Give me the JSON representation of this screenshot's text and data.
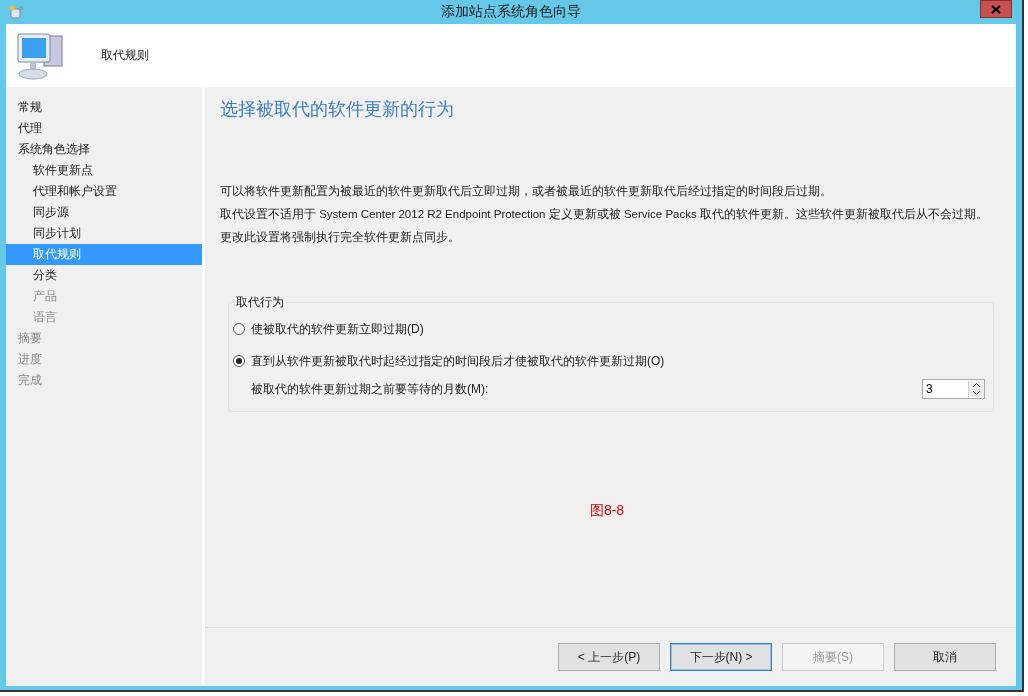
{
  "window": {
    "title": "添加站点系统角色向导"
  },
  "header": {
    "title": "取代规则"
  },
  "nav": [
    {
      "label": "常规",
      "selected": false,
      "disabled": false
    },
    {
      "label": "代理",
      "selected": false,
      "disabled": false
    },
    {
      "label": "系统角色选择",
      "selected": false,
      "disabled": false,
      "children": [
        {
          "label": "软件更新点",
          "selected": false,
          "disabled": false
        },
        {
          "label": "代理和帐户设置",
          "selected": false,
          "disabled": false
        },
        {
          "label": "同步源",
          "selected": false,
          "disabled": false
        },
        {
          "label": "同步计划",
          "selected": false,
          "disabled": false
        },
        {
          "label": "取代规则",
          "selected": true,
          "disabled": false
        },
        {
          "label": "分类",
          "selected": false,
          "disabled": false
        },
        {
          "label": "产品",
          "selected": false,
          "disabled": true
        },
        {
          "label": "语言",
          "selected": false,
          "disabled": true
        }
      ]
    },
    {
      "label": "摘要",
      "selected": false,
      "disabled": true
    },
    {
      "label": "进度",
      "selected": false,
      "disabled": true
    },
    {
      "label": "完成",
      "selected": false,
      "disabled": true
    }
  ],
  "page": {
    "heading": "选择被取代的软件更新的行为",
    "paragraphs": [
      "可以将软件更新配置为被最近的软件更新取代后立即过期，或者被最近的软件更新取代后经过指定的时间段后过期。",
      "取代设置不适用于 System Center 2012 R2 Endpoint Protection 定义更新或被 Service Packs 取代的软件更新。这些软件更新被取代后从不会过期。",
      "更改此设置将强制执行完全软件更新点同步。"
    ],
    "group": {
      "title": "取代行为",
      "options": [
        {
          "label": "使被取代的软件更新立即过期(D)",
          "selected": false
        },
        {
          "label": "直到从软件更新被取代时起经过指定的时间段后才使被取代的软件更新过期(O)",
          "selected": true
        }
      ],
      "months_label": "被取代的软件更新过期之前要等待的月数(M):",
      "months_value": "3"
    },
    "caption": "图8-8"
  },
  "buttons": [
    {
      "label": "< 上一步(P)",
      "disabled": false,
      "default": false
    },
    {
      "label": "下一步(N) >",
      "disabled": false,
      "default": true
    },
    {
      "label": "摘要(S)",
      "disabled": true,
      "default": false
    },
    {
      "label": "取消",
      "disabled": false,
      "default": false
    }
  ]
}
